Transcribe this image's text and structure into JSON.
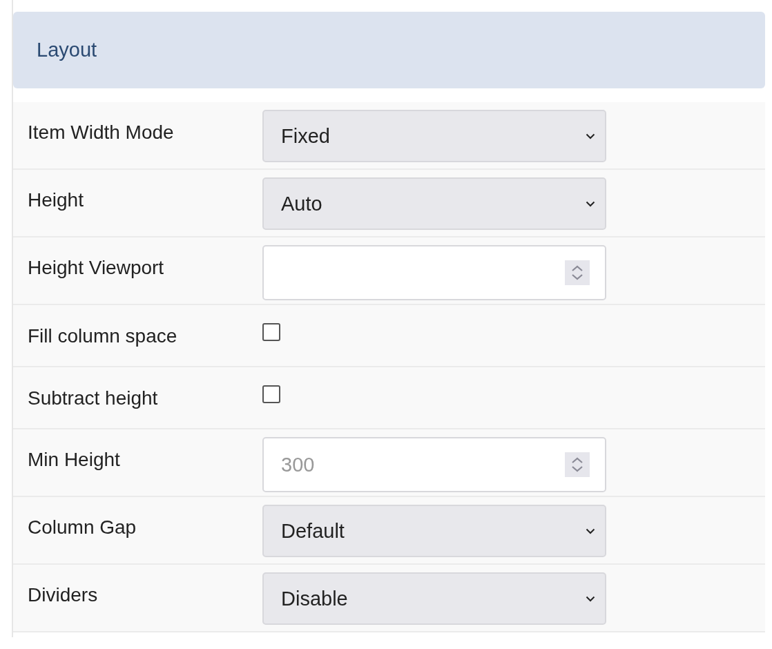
{
  "section": {
    "title": "Layout"
  },
  "fields": [
    {
      "label": "Item Width Mode",
      "kind": "select",
      "value": "Fixed"
    },
    {
      "label": "Height",
      "kind": "select",
      "value": "Auto"
    },
    {
      "label": "Height Viewport",
      "kind": "number"
    },
    {
      "label": "Fill column space",
      "kind": "checkbox",
      "checked": false
    },
    {
      "label": "Subtract height",
      "kind": "checkbox",
      "checked": false
    },
    {
      "label": "Min Height",
      "kind": "number",
      "placeholder": "300"
    },
    {
      "label": "Column Gap",
      "kind": "select",
      "value": "Default"
    },
    {
      "label": "Dividers",
      "kind": "select",
      "value": "Disable"
    }
  ]
}
